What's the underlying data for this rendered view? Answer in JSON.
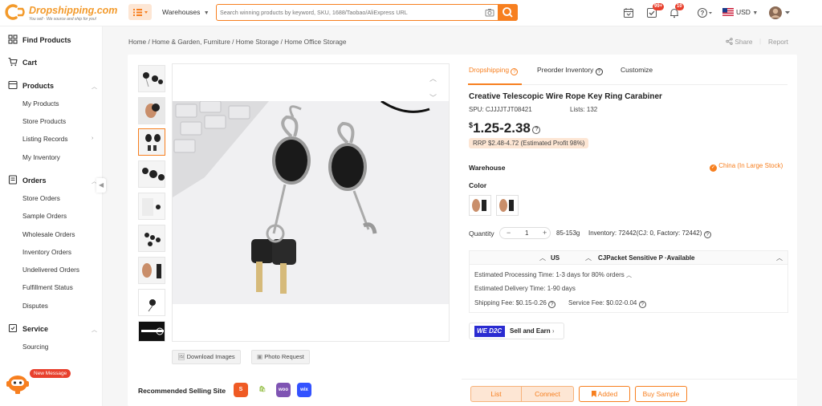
{
  "header": {
    "logo_text": "Dropshipping.com",
    "logo_tagline": "You sell · We source and ship for you!",
    "warehouse_label": "Warehouses",
    "search_placeholder": "Search winning products by keyword, SKU, 1688/Taobao/AliExpress URL",
    "task_badge": "99+",
    "bell_badge": "10",
    "currency": "USD",
    "icons": [
      "menu-icon",
      "chevron-down-icon",
      "camera-icon",
      "search-icon",
      "calendar-icon",
      "task-check-icon",
      "bell-icon",
      "help-icon",
      "us-flag-icon",
      "avatar"
    ],
    "accent_color": "#f77f1f"
  },
  "sidebar": {
    "find_products": "Find Products",
    "cart": "Cart",
    "products": {
      "title": "Products",
      "items": [
        "My Products",
        "Store Products",
        "Listing Records",
        "My Inventory"
      ]
    },
    "orders": {
      "title": "Orders",
      "items": [
        "Store Orders",
        "Sample Orders",
        "Wholesale Orders",
        "Inventory Orders",
        "Undelivered Orders",
        "Fulfillment Status",
        "Disputes"
      ]
    },
    "service": {
      "title": "Service",
      "items": [
        "Sourcing"
      ]
    },
    "new_message": "New Message"
  },
  "breadcrumb": [
    "Home",
    "Home & Garden, Furniture",
    "Home Storage",
    "Home Office Storage"
  ],
  "breadcrumb_sep": "/",
  "actions": {
    "share": "Share",
    "report": "Report"
  },
  "gallery": {
    "download_label": "Download Images",
    "photo_request_label": "Photo Request",
    "thumbnail_count": 9,
    "selected_thumbnail": 3
  },
  "recommended": {
    "label": "Recommended Selling Site",
    "sites": [
      "shopify",
      "shopify-bag",
      "woo",
      "wix"
    ]
  },
  "tabs": [
    "Dropshipping",
    "Preorder Inventory",
    "Customize"
  ],
  "product": {
    "title": "Creative Telescopic Wire Rope Key Ring Carabiner",
    "spu_label": "SPU:",
    "spu": "CJJJJTJT08421",
    "lists_label": "Lists:",
    "lists": "132",
    "currency_symbol": "$",
    "price": "1.25-2.38",
    "rrp": "RRP $2.48-4.72 (Estimated Profit 98%)",
    "warehouse_label": "Warehouse",
    "warehouse_value": "China (In Large Stock)",
    "color_label": "Color",
    "quantity_label": "Quantity",
    "quantity": "1",
    "minus": "−",
    "plus": "+",
    "weight": "85-153g",
    "inventory": "Inventory: 72442(CJ: 0, Factory: 72442)"
  },
  "shipping": {
    "country": "US",
    "method": "CJPacket Sensitive P ·Available",
    "processing": "Estimated Processing Time: 1-3 days for 80% orders",
    "delivery": "Estimated Delivery Time: 1-90 days",
    "shipping_fee": "Shipping Fee: $0.15-0.26",
    "service_fee": "Service Fee: $0.02-0.04"
  },
  "d2c": {
    "logo": "WE D2C",
    "label": "Sell and Earn"
  },
  "bottom": {
    "list": "List",
    "connect": "Connect",
    "added": "Added",
    "buy_sample": "Buy Sample"
  }
}
